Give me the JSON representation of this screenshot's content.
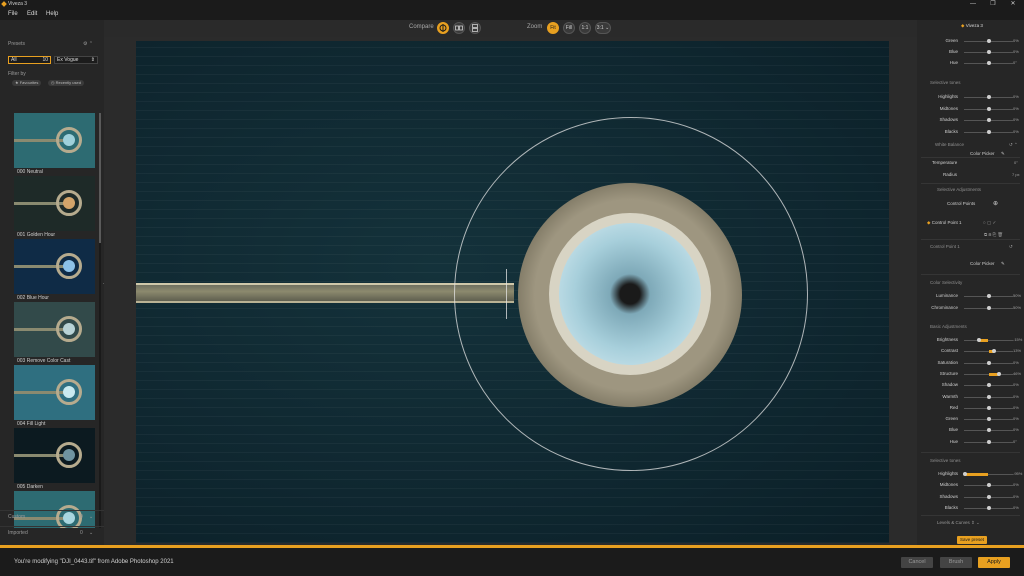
{
  "window": {
    "title": "Viveza 3",
    "controls": [
      "—",
      "❐",
      "✕"
    ]
  },
  "menu": [
    "File",
    "Edit",
    "Help"
  ],
  "toolbar": {
    "compare_label": "Compare",
    "zoom_label": "Zoom",
    "zoom_buttons": [
      "Fit",
      "Fill",
      "1:1",
      "3:1 ⌄"
    ]
  },
  "left": {
    "presets_label": "Presets",
    "tab_all": "All",
    "tab_all_count": "10",
    "collection": "Ex Vogue",
    "filter_label": "Filter by",
    "pills": [
      "Favourites",
      "Recently used"
    ],
    "presets": [
      {
        "name": "000 Neutral",
        "tint": "#2d6b72",
        "dome": "#9fd0da"
      },
      {
        "name": "001 Golden Hour",
        "tint": "#1e2a28",
        "dome": "#d3a46a"
      },
      {
        "name": "002 Blue Hour",
        "tint": "#0f2b46",
        "dome": "#8cc1e8"
      },
      {
        "name": "003 Remove Color Cast",
        "tint": "#324a4a",
        "dome": "#b9d3d6"
      },
      {
        "name": "004 Fill Light",
        "tint": "#2f6f80",
        "dome": "#c9eaf0"
      },
      {
        "name": "005 Darken",
        "tint": "#0c1a20",
        "dome": "#6f93a0"
      },
      {
        "name": "006",
        "tint": "#2d6b72",
        "dome": "#a8d6df"
      }
    ],
    "custom_label": "Custom",
    "custom_count": "0",
    "imported_label": "Imported",
    "imported_count": "0"
  },
  "right": {
    "brand": "Viveza 3",
    "top_rows": [
      {
        "label": "Green",
        "knob": 0.5,
        "val": "0%"
      },
      {
        "label": "Blue",
        "knob": 0.5,
        "val": "0%"
      },
      {
        "label": "Hue",
        "knob": 0.5,
        "val": "0°"
      }
    ],
    "sel_tones_1": "Selective tones",
    "tones_1": [
      {
        "label": "Highlights",
        "knob": 0.5,
        "val": "0%"
      },
      {
        "label": "Midtones",
        "knob": 0.5,
        "val": "0%"
      },
      {
        "label": "Shadows",
        "knob": 0.5,
        "val": "0%"
      },
      {
        "label": "Blacks",
        "knob": 0.5,
        "val": "0%"
      }
    ],
    "white_balance": "White Balance",
    "color_picker": "Color Picker",
    "temperature": "Temperature",
    "temperature_val": "0°",
    "radius": "Radius",
    "radius_val": "7 px",
    "selective_adjustments": "Selective Adjustments",
    "control_points": "Control Points",
    "cp1": "Control Point 1",
    "cp1_header": "Control Point 1",
    "color_picker_2": "Color Picker",
    "color_selectivity": "Color Selectivity",
    "selectivity": [
      {
        "label": "Luminance",
        "knob": 0.5,
        "val": "50%"
      },
      {
        "label": "Chrominance",
        "knob": 0.5,
        "val": "50%"
      }
    ],
    "basic_adjustments": "Basic Adjustments",
    "basic": [
      {
        "label": "Brightness",
        "knob": 0.3,
        "val": "-15%",
        "fill": [
          0.3,
          0.5
        ]
      },
      {
        "label": "Contrast",
        "knob": 0.62,
        "val": "13%",
        "fill": [
          0.5,
          0.62
        ]
      },
      {
        "label": "Saturation",
        "knob": 0.5,
        "val": "0%"
      },
      {
        "label": "Structure",
        "knob": 0.72,
        "val": "46%",
        "fill": [
          0.5,
          0.72
        ]
      },
      {
        "label": "Shadow",
        "knob": 0.5,
        "val": "0%"
      },
      {
        "label": "Warmth",
        "knob": 0.5,
        "val": "0%"
      },
      {
        "label": "Red",
        "knob": 0.5,
        "val": "0%"
      },
      {
        "label": "Green",
        "knob": 0.5,
        "val": "0%"
      },
      {
        "label": "Blue",
        "knob": 0.5,
        "val": "0%"
      },
      {
        "label": "Hue",
        "knob": 0.5,
        "val": "0°"
      }
    ],
    "sel_tones_2": "Selective tones",
    "tones_2": [
      {
        "label": "Highlights",
        "knob": 0.02,
        "val": "-95%",
        "fill": [
          0.02,
          0.5
        ]
      },
      {
        "label": "Midtones",
        "knob": 0.5,
        "val": "0%"
      },
      {
        "label": "Shadows",
        "knob": 0.5,
        "val": "0%"
      },
      {
        "label": "Blacks",
        "knob": 0.5,
        "val": "0%"
      }
    ],
    "levels_curves": "Levels & Curves",
    "save_preset": "Save preset"
  },
  "status": {
    "message": "You're modifying \"DJI_0443.tif\" from Adobe Photoshop 2021",
    "cancel": "Cancel",
    "brush": "Brush",
    "apply": "Apply"
  },
  "colors": {
    "accent": "#e8a020",
    "panel": "#262626",
    "canvas": "#2b2b2b"
  }
}
